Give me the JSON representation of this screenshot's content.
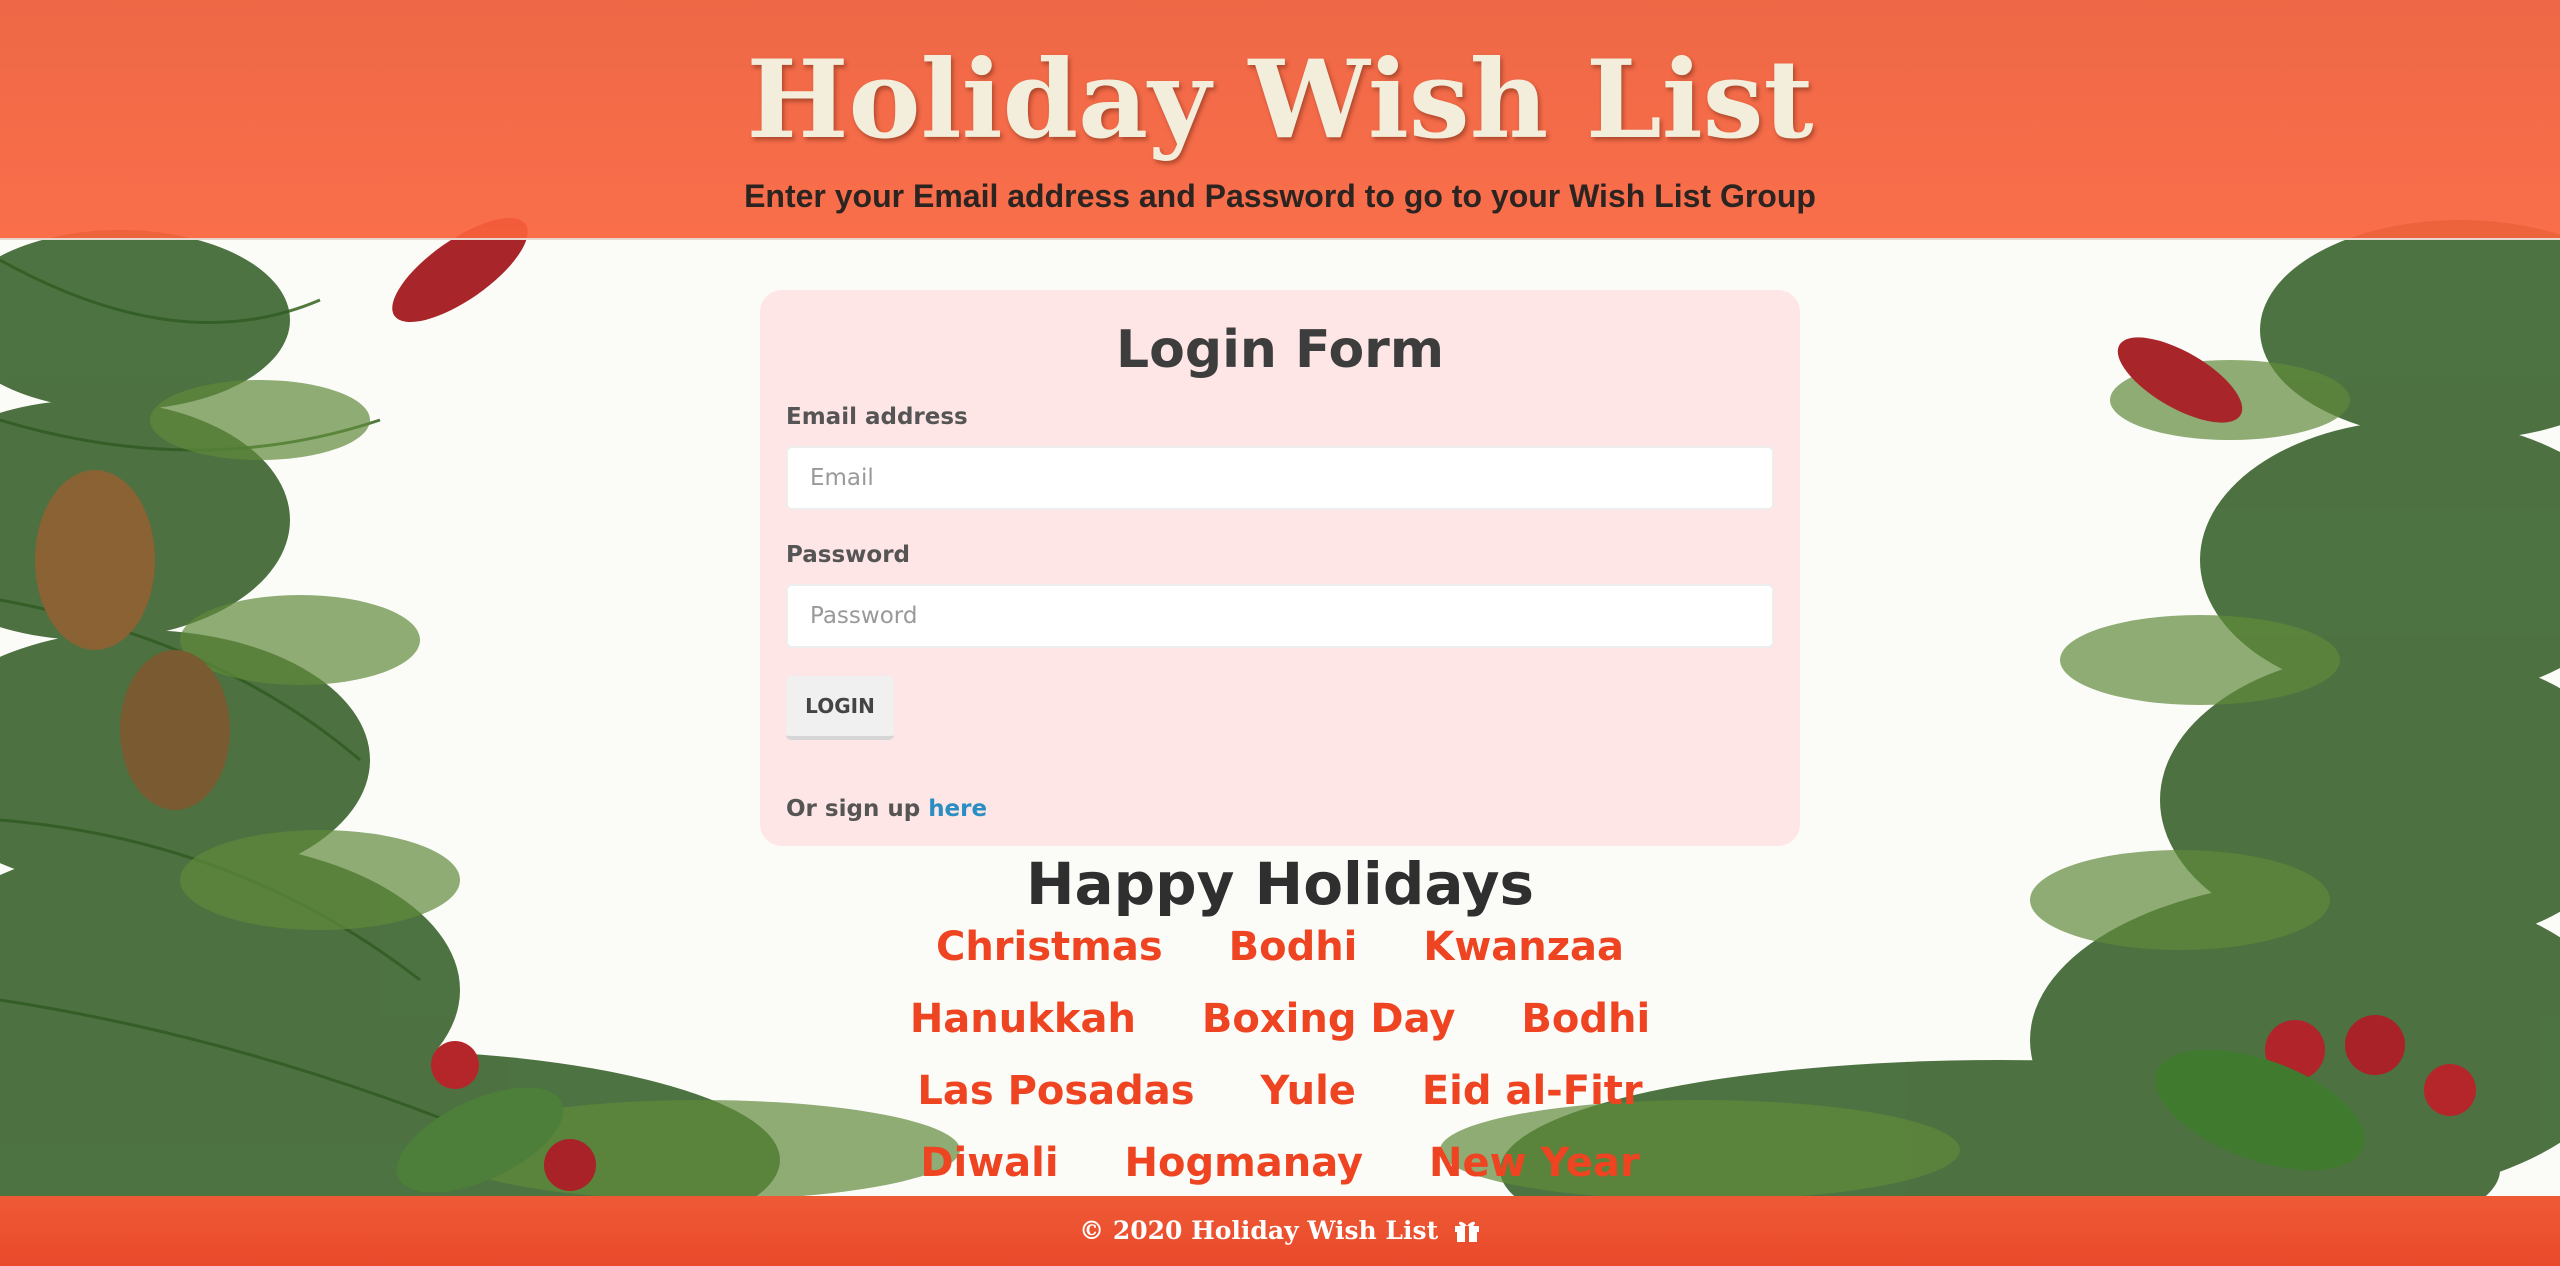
{
  "header": {
    "title": "Holiday Wish List",
    "subtitle": "Enter your Email address and Password to go to your Wish List Group"
  },
  "login_form": {
    "title": "Login Form",
    "email_label": "Email address",
    "email_placeholder": "Email",
    "email_value": "",
    "password_label": "Password",
    "password_placeholder": "Password",
    "password_value": "",
    "login_button": "LOGIN",
    "signup_prefix": "Or sign up",
    "signup_link": "here"
  },
  "holidays": {
    "title": "Happy Holidays",
    "rows": [
      [
        "Christmas",
        "Bodhi",
        "Kwanzaa"
      ],
      [
        "Hanukkah",
        "Boxing Day",
        "Bodhi"
      ],
      [
        "Las Posadas",
        "Yule",
        "Eid al-Fitr"
      ],
      [
        "Diwali",
        "Hogmanay",
        "New Year"
      ]
    ]
  },
  "footer": {
    "text": "© 2020 Holiday Wish List",
    "icon": "gift-icon"
  },
  "colors": {
    "header_bg": "#f05a3a",
    "card_bg": "#ffe6e6",
    "holiday_text": "#ee4422",
    "link": "#2a8ec2",
    "footer_bg": "#ec4f2d"
  }
}
